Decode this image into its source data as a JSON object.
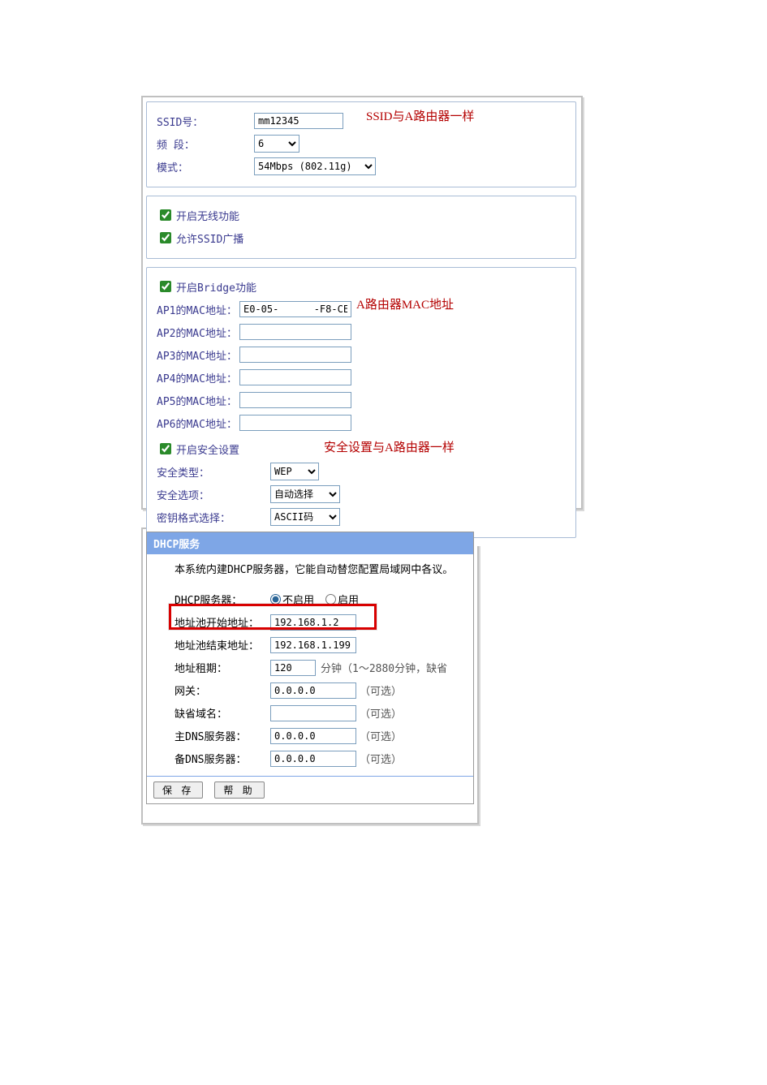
{
  "wireless": {
    "ssid_label": "SSID号：",
    "ssid_value": "mm12345",
    "channel_label": "频 段：",
    "channel_value": "6",
    "mode_label": "模式：",
    "mode_value": "54Mbps (802.11g)",
    "enable_wireless_label": "开启无线功能",
    "allow_ssid_bcast_label": "允许SSID广播",
    "enable_bridge_label": "开启Bridge功能",
    "ap_mac_labels": [
      "AP1的MAC地址：",
      "AP2的MAC地址：",
      "AP3的MAC地址：",
      "AP4的MAC地址：",
      "AP5的MAC地址：",
      "AP6的MAC地址："
    ],
    "ap1_mac_value": "E0-05-      -F8-CE",
    "enable_security_label": "开启安全设置",
    "security_type_label": "安全类型：",
    "security_type_value": "WEP",
    "security_option_label": "安全选项：",
    "security_option_value": "自动选择",
    "key_format_label": "密钥格式选择：",
    "key_format_value": "ASCII码"
  },
  "annotations": {
    "a1": "SSID与A路由器一样",
    "a2": "A路由器MAC地址",
    "a3": "安全设置与A路由器一样"
  },
  "dhcp": {
    "header": "DHCP服务",
    "desc": "本系统内建DHCP服务器，它能自动替您配置局域网中各议。",
    "server_label": "DHCP服务器：",
    "radio_disable": "不启用",
    "radio_enable": "启用",
    "pool_start_label": "地址池开始地址：",
    "pool_start_value": "192.168.1.2",
    "pool_end_label": "地址池结束地址：",
    "pool_end_value": "192.168.1.199",
    "lease_label": "地址租期：",
    "lease_value": "120",
    "lease_hint": "分钟（1～2880分钟，缺省",
    "gateway_label": "网关：",
    "gateway_value": "0.0.0.0",
    "domain_label": "缺省域名：",
    "domain_value": "",
    "dns1_label": "主DNS服务器：",
    "dns1_value": "0.0.0.0",
    "dns2_label": "备DNS服务器：",
    "dns2_value": "0.0.0.0",
    "optional": "（可选）",
    "btn_save": "保 存",
    "btn_help": "帮 助"
  }
}
